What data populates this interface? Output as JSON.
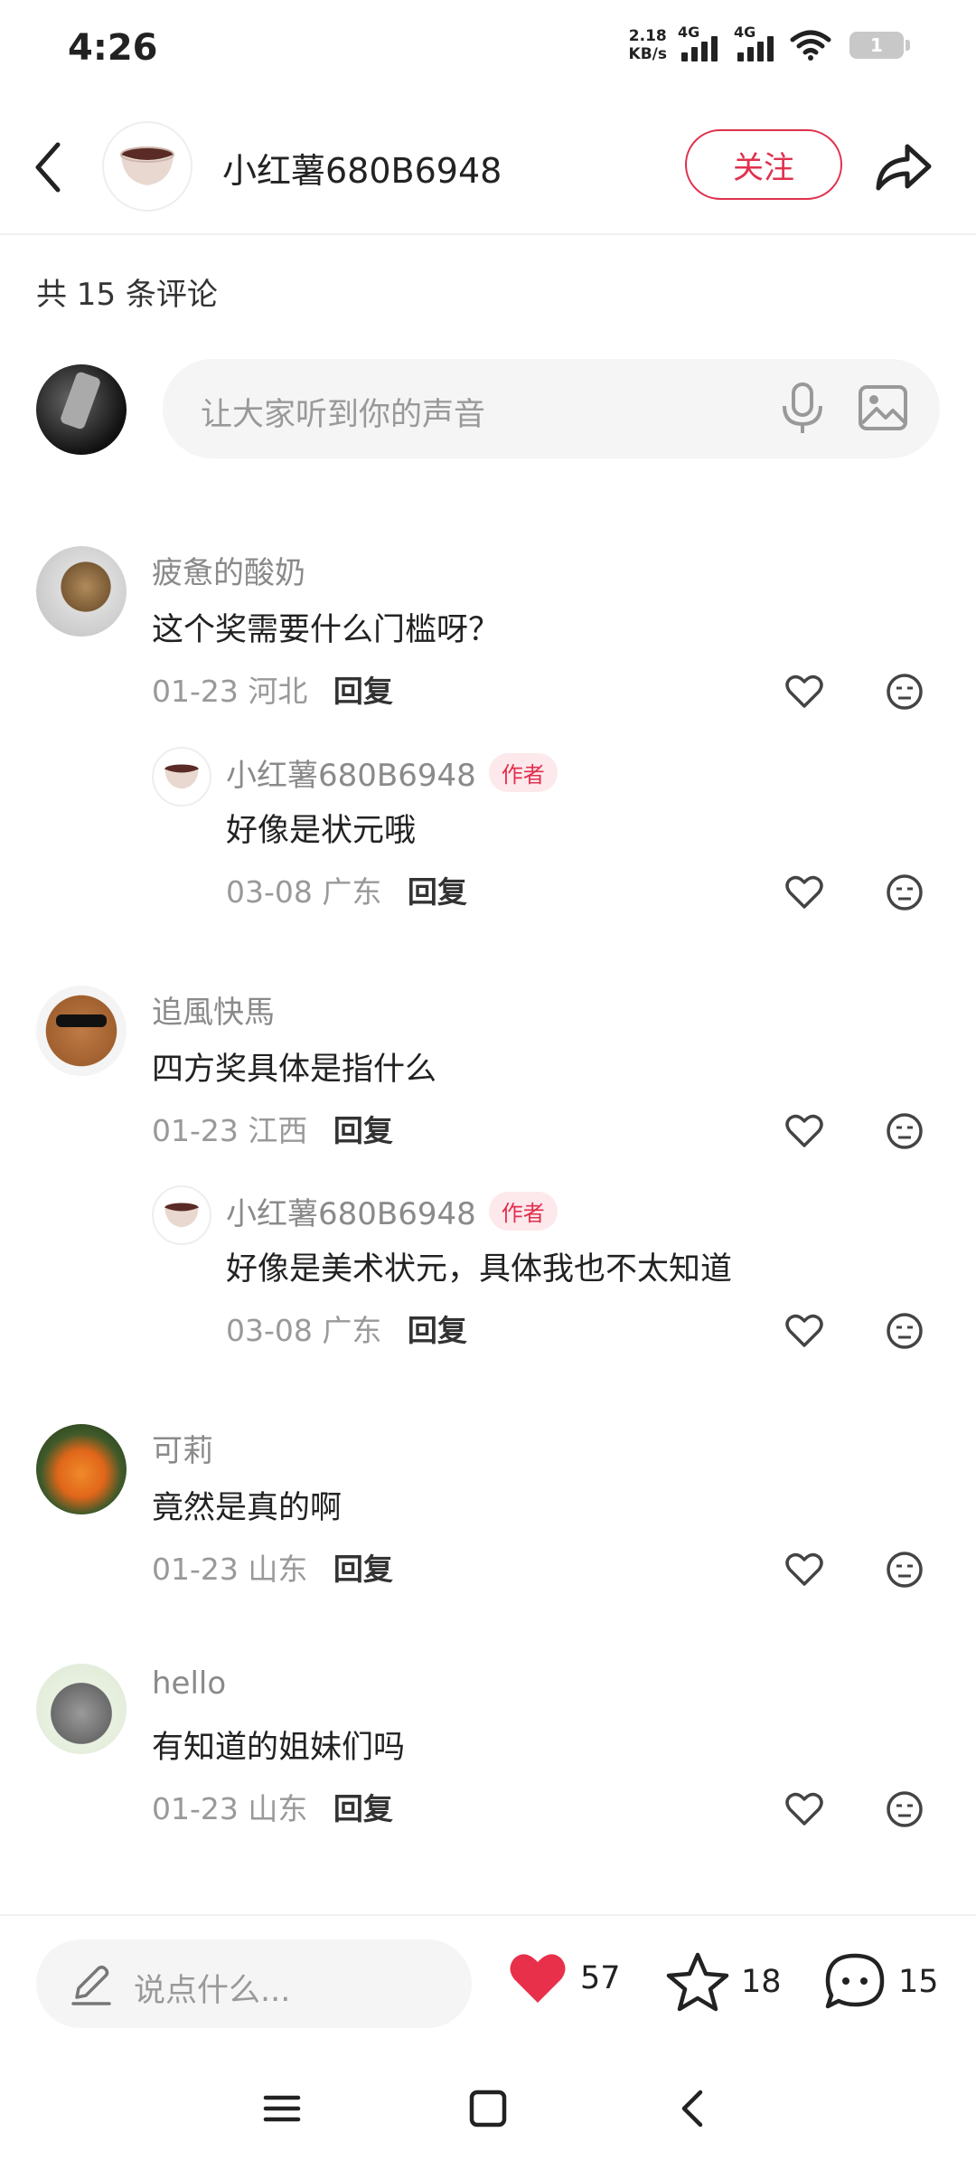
{
  "status": {
    "time": "4:26",
    "net_speed_value": "2.18",
    "net_speed_unit": "KB/s",
    "signal1_label": "4G",
    "signal2_label": "4G",
    "battery": "1"
  },
  "header": {
    "author_name": "小红薯680B6948",
    "follow_label": "关注"
  },
  "comments_header": {
    "count_text": "共 15 条评论",
    "input_placeholder": "让大家听到你的声音"
  },
  "comments": [
    {
      "name": "疲惫的酸奶",
      "text": "这个奖需要什么门槛呀？",
      "meta": "01-23 河北",
      "reply_label": "回复",
      "reply": {
        "name": "小红薯680B6948",
        "tag": "作者",
        "text": "好像是状元哦",
        "meta": "03-08 广东",
        "reply_label": "回复"
      }
    },
    {
      "name": "追風快馬",
      "text": "四方奖具体是指什么",
      "meta": "01-23 江西",
      "reply_label": "回复",
      "reply": {
        "name": "小红薯680B6948",
        "tag": "作者",
        "text": "好像是美术状元，具体我也不太知道",
        "meta": "03-08 广东",
        "reply_label": "回复"
      }
    },
    {
      "name": "可莉",
      "text": "竟然是真的啊",
      "meta": "01-23 山东",
      "reply_label": "回复"
    },
    {
      "name": "hello",
      "text": "有知道的姐妹们吗",
      "meta": "01-23 山东",
      "reply_label": "回复"
    }
  ],
  "bottom_bar": {
    "say_placeholder": "说点什么...",
    "likes": "57",
    "favorites": "18",
    "comments": "15",
    "like_color": "#e8304a"
  },
  "colors": {
    "accent": "#e0304d",
    "tag_bg": "#fde8ec"
  }
}
